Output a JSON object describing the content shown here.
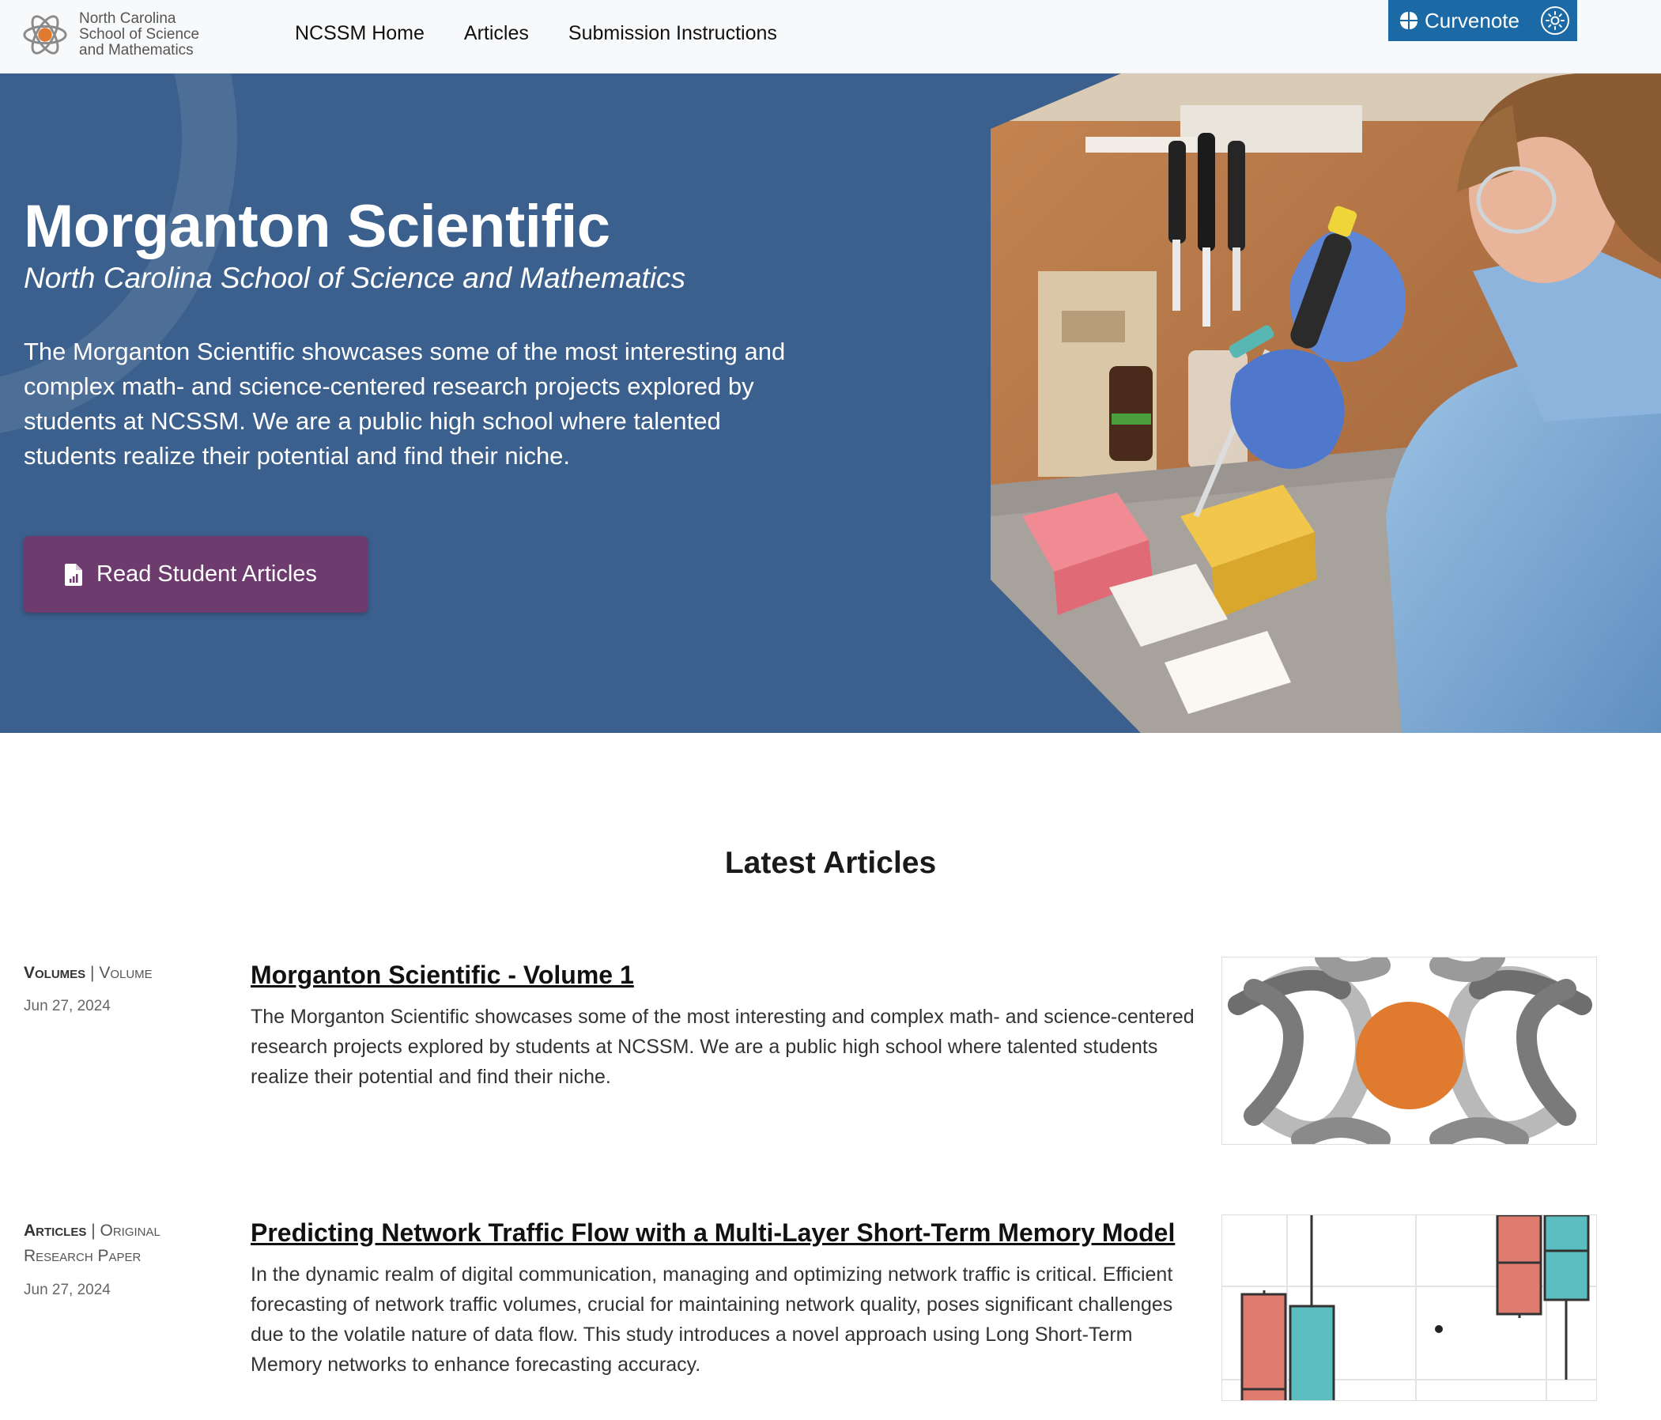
{
  "nav": {
    "brand_line1": "North Carolina",
    "brand_line2": "School of Science",
    "brand_line3": "and Mathematics",
    "links": [
      "NCSSM Home",
      "Articles",
      "Submission Instructions"
    ],
    "curvenote_label": "Curvenote"
  },
  "hero": {
    "title": "Morganton Scientific",
    "subtitle": "North Carolina School of Science and Mathematics",
    "description": "The Morganton Scientific showcases some of the most interesting and complex math- and science-centered research projects explored by students at NCSSM. We are a public high school where talented students realize their potential and find their niche.",
    "cta_label": "Read Student Articles"
  },
  "articles": {
    "section_title": "Latest Articles",
    "items": [
      {
        "kind": "Volumes",
        "subkind": "Volume",
        "date": "Jun 27, 2024",
        "title": "Morganton Scientific - Volume 1",
        "description": "The Morganton Scientific showcases some of the most interesting and complex math- and science-centered research projects explored by students at NCSSM. We are a public high school where talented students realize their potential and find their niche."
      },
      {
        "kind": "Articles",
        "subkind": "Original Research Paper",
        "date": "Jun 27, 2024",
        "title": "Predicting Network Traffic Flow with a Multi-Layer Short-Term Memory Model",
        "description": "In the dynamic realm of digital communication, managing and optimizing network traffic is critical. Efficient forecasting of network traffic volumes, crucial for maintaining network quality, poses significant challenges due to the volatile nature of data flow. This study introduces a novel approach using Long Short-Term Memory networks to enhance forecasting accuracy."
      }
    ]
  },
  "colors": {
    "hero_bg": "#3b608d",
    "cta_bg": "#6e3b6f",
    "curvenote_bg": "#1b6aa5",
    "logo_orange": "#df7a2e",
    "box_red": "#e07b6f",
    "box_teal": "#5bbdbf"
  }
}
